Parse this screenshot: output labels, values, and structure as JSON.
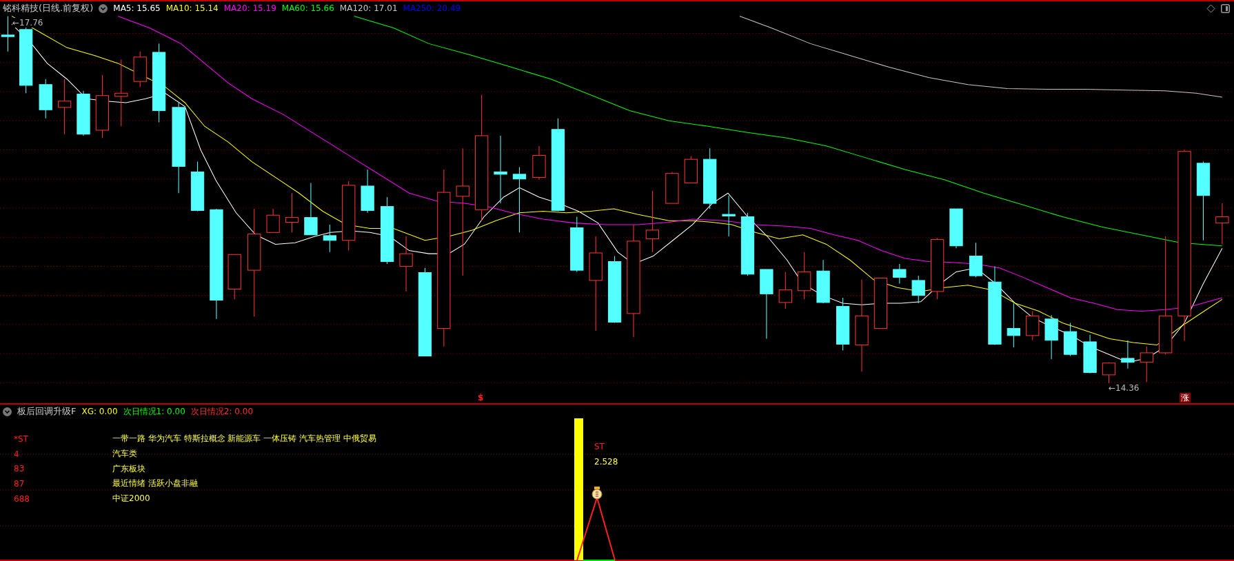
{
  "header": {
    "title": "铭科精技(日线.前复权)",
    "indicators": [
      {
        "label": "MA5: 15.65",
        "color": "#ffffff"
      },
      {
        "label": "MA10: 15.14",
        "color": "#ffff00"
      },
      {
        "label": "MA20: 15.19",
        "color": "#ff00ff"
      },
      {
        "label": "MA60: 15.66",
        "color": "#00ff00"
      },
      {
        "label": "MA120: 17.01",
        "color": "#c8c8c8"
      },
      {
        "label": "MA250: 20.49",
        "color": "#0000ff"
      }
    ]
  },
  "main_chart": {
    "high_label": "←17.76",
    "low_label": "←14.36",
    "markers": [
      {
        "kind": "dollar",
        "text": "$"
      },
      {
        "kind": "badge",
        "text": "涨"
      }
    ]
  },
  "lower_panel": {
    "title": "板后回调升级F",
    "readings": [
      {
        "label": "XG: 0.00",
        "color": "#ffff00"
      },
      {
        "label": "次日情况1: 0.00",
        "color": "#00ff00"
      },
      {
        "label": "次日情况2: 0.00",
        "color": "#ff3030"
      }
    ],
    "rows": [
      {
        "code": "*ST",
        "text": "一带一路 华为汽车 特斯拉概念 新能源车 一体压铸 汽车热管理 中俄贸易"
      },
      {
        "code": "4",
        "text": "汽车类"
      },
      {
        "code": "83",
        "text": "广东板块"
      },
      {
        "code": "87",
        "text": "最近情绪 活跃小盘非融"
      },
      {
        "code": "688",
        "text": "中证2000"
      }
    ],
    "signal": {
      "label": "ST",
      "value": "2.528"
    }
  }
}
